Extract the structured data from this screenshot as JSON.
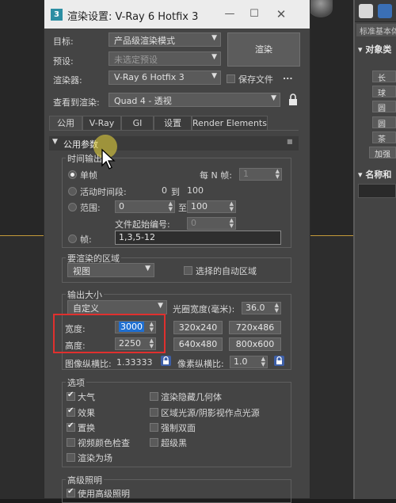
{
  "window": {
    "title": "渲染设置: V-Ray 6 Hotfix 3",
    "logo": "3"
  },
  "settings": {
    "target_label": "目标:",
    "target_value": "产品级渲染模式",
    "preset_label": "预设:",
    "preset_value": "未选定预设",
    "renderer_label": "渲染器:",
    "renderer_value": "V-Ray 6 Hotfix 3",
    "save_file_label": "保存文件",
    "more_label": "...",
    "view_label": "查看到渲染:",
    "view_value": "Quad 4 - 透视",
    "render_button": "渲染"
  },
  "tabs": [
    "公用",
    "V-Ray",
    "GI",
    "设置",
    "Render Elements"
  ],
  "rollout": {
    "title": "公用参数"
  },
  "time_output": {
    "title": "时间输出",
    "single_label": "单帧",
    "every_n_label": "每 N 帧:",
    "every_n_value": "1",
    "active_segment_label": "活动时间段:",
    "active_from": "0",
    "to_label": "到",
    "active_to": "100",
    "range_label": "范围:",
    "range_from": "0",
    "range_to_label": "至",
    "range_to": "100",
    "file_number_label": "文件起始编号:",
    "file_number_value": "0",
    "frames_label": "帧:",
    "frames_value": "1,3,5-12"
  },
  "render_area": {
    "title": "要渲染的区域",
    "value": "视图",
    "auto_region_label": "选择的自动区域"
  },
  "output_size": {
    "title": "输出大小",
    "preset_value": "自定义",
    "aperture_label": "光圈宽度(毫米):",
    "aperture_value": "36.0",
    "width_label": "宽度:",
    "width_value": "3000",
    "height_label": "高度:",
    "height_value": "2250",
    "presets": [
      "320x240",
      "720x486",
      "640x480",
      "800x600"
    ],
    "image_aspect_label": "图像纵横比:",
    "image_aspect_value": "1.33333",
    "pixel_aspect_label": "像素纵横比:",
    "pixel_aspect_value": "1.0"
  },
  "options": {
    "title": "选项",
    "items": [
      {
        "label": "大气",
        "checked": true
      },
      {
        "label": "渲染隐藏几何体",
        "checked": false
      },
      {
        "label": "效果",
        "checked": true
      },
      {
        "label": "区域光源/阴影视作点光源",
        "checked": false
      },
      {
        "label": "置换",
        "checked": true
      },
      {
        "label": "强制双面",
        "checked": false
      },
      {
        "label": "视频颜色检查",
        "checked": false
      },
      {
        "label": "超级黑",
        "checked": false
      },
      {
        "label": "渲染为场",
        "checked": false
      }
    ]
  },
  "advanced_lighting": {
    "title": "高级照明",
    "use_label": "使用高级照明",
    "use_checked": true
  },
  "command_panel": {
    "dropdown": "标准基本体",
    "object_type_heading": "对象类",
    "buttons": [
      "长",
      "球",
      "圆",
      "圆",
      "茶",
      "加强"
    ],
    "name_heading": "名称和"
  }
}
